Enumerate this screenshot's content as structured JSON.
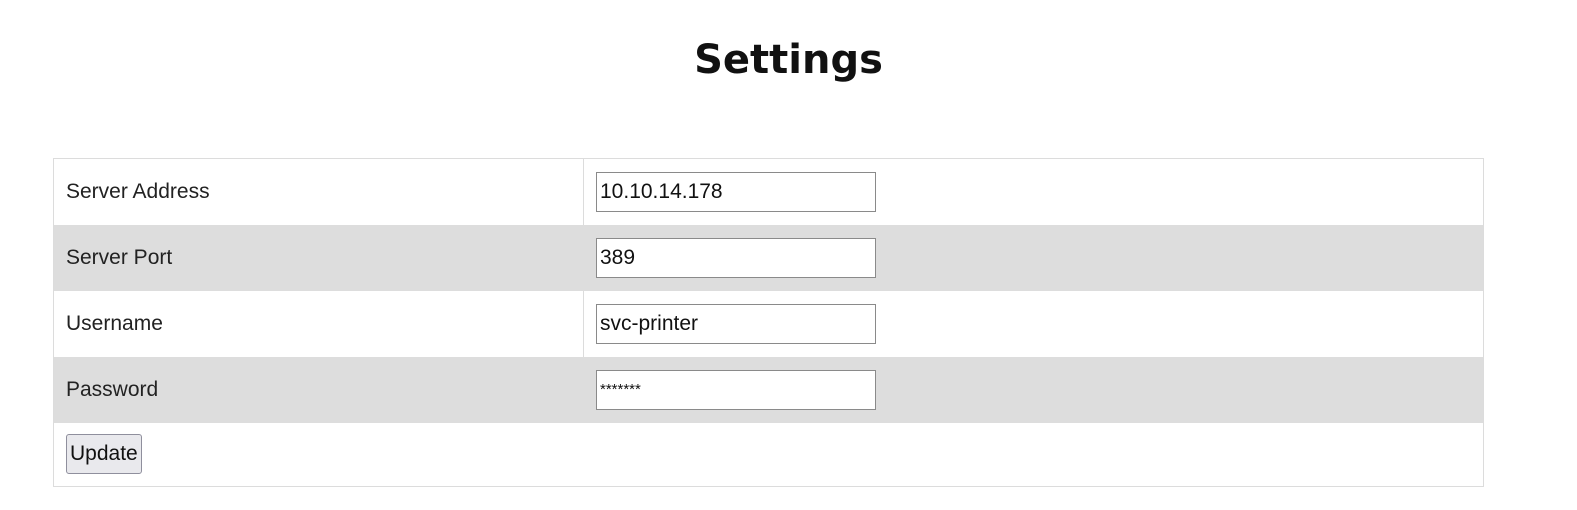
{
  "page": {
    "title": "Settings"
  },
  "form": {
    "fields": [
      {
        "label": "Server Address",
        "value": "10.10.14.178",
        "type": "text"
      },
      {
        "label": "Server Port",
        "value": "389",
        "type": "text"
      },
      {
        "label": "Username",
        "value": "svc-printer",
        "type": "text"
      },
      {
        "label": "Password",
        "value": "*******",
        "type": "text"
      }
    ],
    "submit_label": "Update"
  },
  "colors": {
    "row_shade": "#dddddd",
    "border": "#dcdcdc",
    "button_bg": "#e9e9ed"
  }
}
